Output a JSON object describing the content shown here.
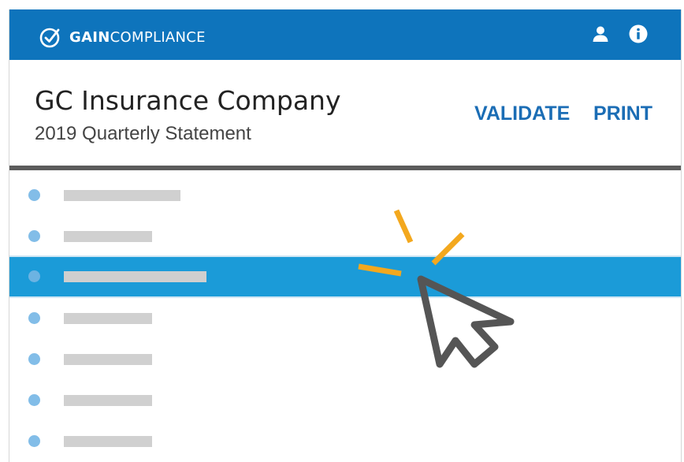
{
  "brand": {
    "name_bold": "GAIN",
    "name_light": "COMPLIANCE",
    "logo_icon": "check-circle-logo-icon",
    "primary_color": "#0e74bc"
  },
  "topbar": {
    "icons": [
      "user-icon",
      "info-icon"
    ]
  },
  "header": {
    "company": "GC Insurance Company",
    "statement": "2019 Quarterly Statement",
    "actions": {
      "validate": "VALIDATE",
      "print": "PRINT"
    }
  },
  "list": {
    "selected_index": 2,
    "selected_color": "#1b9bd8",
    "items": [
      {
        "placeholder": true
      },
      {
        "placeholder": true
      },
      {
        "placeholder": true,
        "selected": true
      },
      {
        "placeholder": true
      },
      {
        "placeholder": true
      },
      {
        "placeholder": true
      },
      {
        "placeholder": true
      }
    ]
  },
  "overlay": {
    "icon": "mouse-pointer-click-icon",
    "accent_color": "#f3a81e",
    "pointer_color": "#555555"
  }
}
